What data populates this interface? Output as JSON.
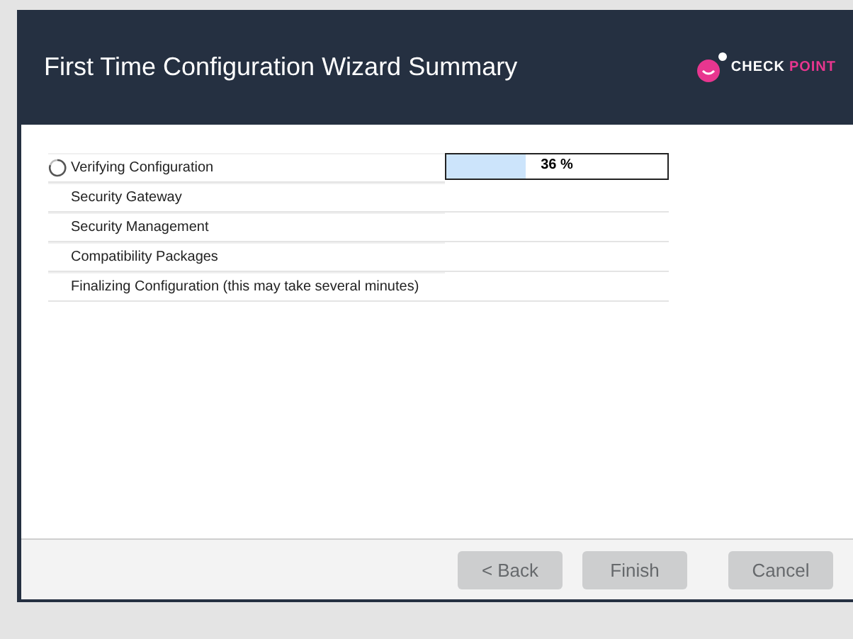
{
  "window": {
    "title": "First Time Configuration Wizard Summary"
  },
  "logo": {
    "word_1": "CHECK",
    "word_2": "POINT"
  },
  "steps": [
    {
      "label": "Verifying Configuration",
      "active": true,
      "level": 0.36,
      "reading": "36 %"
    },
    {
      "label": "Security Gateway",
      "active": false
    },
    {
      "label": "Security Management",
      "active": false
    },
    {
      "label": "Compatibility Packages",
      "active": false
    },
    {
      "label": "Finalizing Configuration (this may take several minutes)",
      "active": false
    }
  ],
  "buttons": [
    {
      "label": "< Back",
      "disabled": true
    },
    {
      "label": "Finish",
      "disabled": true
    },
    {
      "label": "Cancel",
      "disabled": true
    }
  ]
}
